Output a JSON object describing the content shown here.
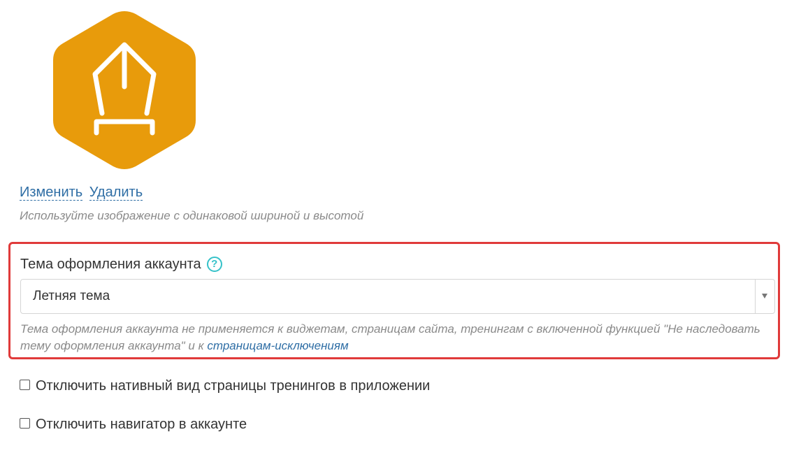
{
  "logo": {
    "icon": "pen-nib-icon",
    "bg_color": "#e89b0b",
    "stroke_color": "#ffffff"
  },
  "image_actions": {
    "change_label": "Изменить",
    "delete_label": "Удалить",
    "hint": "Используйте изображение с одинаковой шириной и высотой"
  },
  "theme": {
    "label": "Тема оформления аккаунта",
    "help_icon": "question-circle-icon",
    "help_symbol": "?",
    "selected_value": "Летняя тема",
    "hint_text": "Тема оформления аккаунта не применяется к виджетам, страницам сайта, тренингам с включенной функцией \"Не наследовать тему оформления аккаунта\" и к ",
    "hint_link": "страницам-исключениям",
    "highlight_color": "#e03a3a"
  },
  "options": {
    "disable_native_view": {
      "label": "Отключить нативный вид страницы тренингов в приложении",
      "checked": false
    },
    "disable_navigator": {
      "label": "Отключить навигатор в аккаунте",
      "checked": false
    }
  }
}
